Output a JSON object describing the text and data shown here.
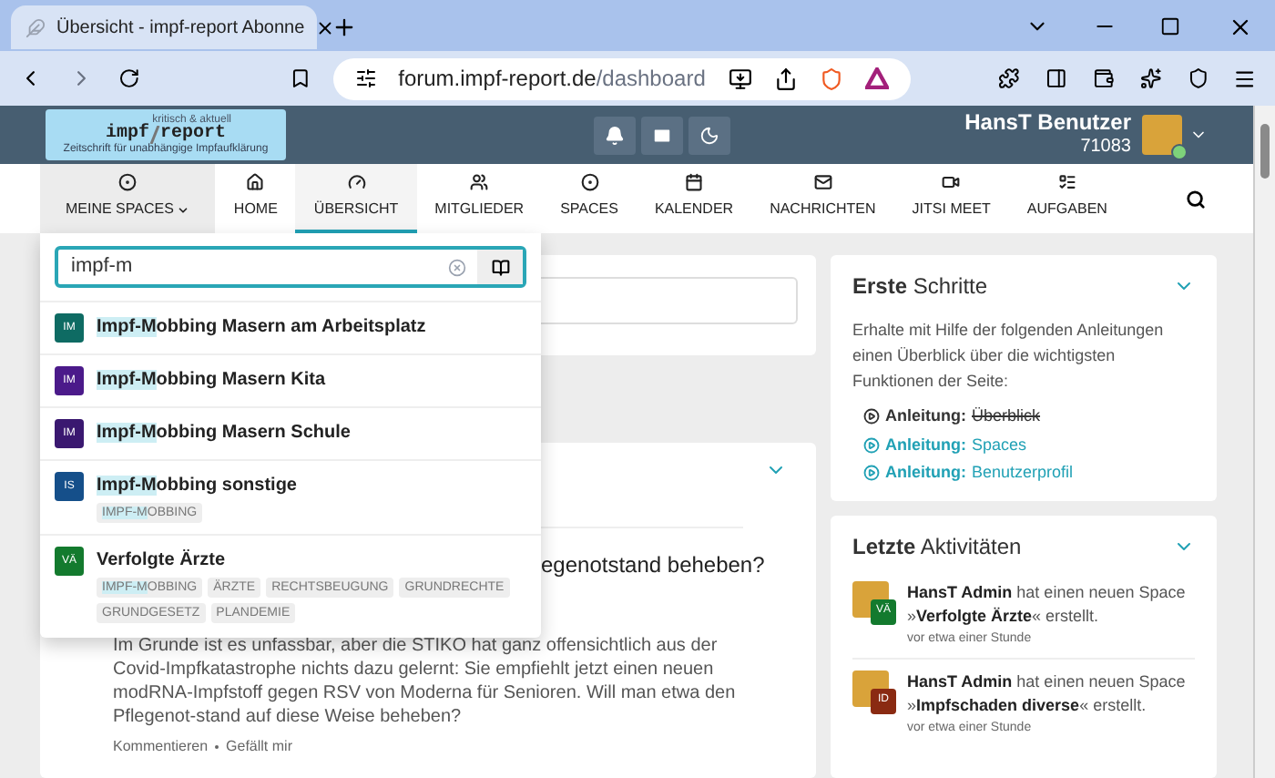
{
  "browser": {
    "tab_title": "Übersicht - impf-report Abonne",
    "url_host": "forum.impf-report.de",
    "url_path": "/dashboard"
  },
  "header": {
    "logo": {
      "left": "impf",
      "right": "report",
      "tagline": "kritisch & aktuell",
      "subtitle": "Zeitschrift für unabhängige Impfaufklärung"
    },
    "user": {
      "name": "HansT Benutzer",
      "id": "71083",
      "online": true
    }
  },
  "nav": [
    {
      "label": "MEINE SPACES",
      "selected": false,
      "open": true
    },
    {
      "label": "HOME",
      "selected": false,
      "open": false
    },
    {
      "label": "ÜBERSICHT",
      "selected": true,
      "open": false
    },
    {
      "label": "MITGLIEDER",
      "selected": false,
      "open": false
    },
    {
      "label": "SPACES",
      "selected": false,
      "open": false
    },
    {
      "label": "KALENDER",
      "selected": false,
      "open": false
    },
    {
      "label": "NACHRICHTEN",
      "selected": false,
      "open": false
    },
    {
      "label": "JITSI MEET",
      "selected": false,
      "open": false
    },
    {
      "label": "AUFGABEN",
      "selected": false,
      "open": false
    }
  ],
  "space_search": {
    "value": "impf-m",
    "results": [
      {
        "initials": "IM",
        "color": "#0e6b63",
        "match": "Impf-M",
        "rest": "obbing Masern am Arbeitsplatz"
      },
      {
        "initials": "IM",
        "color": "#4b1a8a",
        "match": "Impf-M",
        "rest": "obbing Masern Kita"
      },
      {
        "initials": "IM",
        "color": "#3a1870",
        "match": "Impf-M",
        "rest": "obbing Masern Schule"
      },
      {
        "initials": "IS",
        "color": "#154f8a",
        "match": "Impf-M",
        "rest": "obbing sonstige",
        "tags": [
          {
            "match": "IMPF-M",
            "rest": "OBBING"
          }
        ]
      },
      {
        "initials": "VÄ",
        "color": "#137a2e",
        "rest": "Verfolgte Ärzte",
        "tags": [
          {
            "match": "IMPF-M",
            "rest": "OBBING"
          },
          {
            "rest": "ÄRZTE"
          },
          {
            "rest": "RECHTSBEUGUNG"
          },
          {
            "rest": "GRUNDRECHTE"
          },
          {
            "rest": "GRUNDGESETZ"
          },
          {
            "rest": "PLANDEMIE"
          }
        ]
      }
    ]
  },
  "post": {
    "title": "egenotstand beheben?",
    "body": "Im Grunde ist es unfassbar, aber die STIKO hat ganz offensichtlich aus der Covid-Impfkatastrophe nichts dazu gelernt: Sie empfiehlt jetzt einen neuen modRNA-Impfstoff gegen RSV von Moderna für Senioren. Will man etwa den Pflegenot-stand auf diese Weise beheben?",
    "actions": [
      "Kommentieren",
      "Gefällt mir"
    ]
  },
  "getting_started": {
    "title": "**Erste** Schritte",
    "text": "Erhalte mit Hilfe der folgenden Anleitungen einen Überblick über die wichtigsten Funktionen der Seite:",
    "links": [
      {
        "prefix": "Anleitung:",
        "label": "Überblick",
        "done": true
      },
      {
        "prefix": "Anleitung:",
        "label": "Spaces",
        "done": false
      },
      {
        "prefix": "Anleitung:",
        "label": "Benutzerprofil",
        "done": false
      }
    ]
  },
  "activities": {
    "title": "**Letzte** Aktivitäten",
    "items": [
      {
        "text": "**HansT Admin** hat einen neuen Space »**Verfolgte Ärzte**« erstellt.",
        "time": "vor etwa einer Stunde",
        "initials": "VÄ",
        "color": "#137a2e"
      },
      {
        "text": "**HansT Admin** hat einen neuen Space »**Impfschaden diverse**« erstellt.",
        "time": "vor etwa einer Stunde",
        "initials": "ID",
        "color": "#8a2a12"
      }
    ]
  }
}
